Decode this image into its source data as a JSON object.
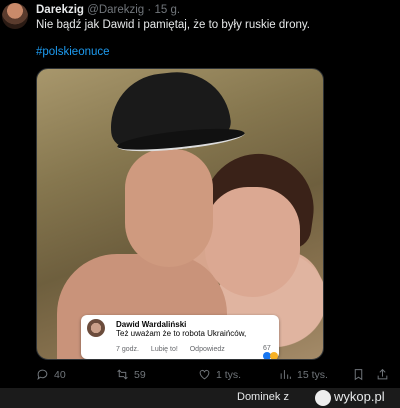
{
  "tweet": {
    "author_name": "Darekzig",
    "author_handle": "@Darekzig",
    "separator": "·",
    "time": "15 g.",
    "text": "Nie bądź jak Dawid i pamiętaj, że to były ruskie drony.",
    "hashtag": "#polskieonuce"
  },
  "embedded_comment": {
    "author": "Dawid Wardaliński",
    "text": "Też uważam że to robota Ukraińców,",
    "time": "7 godz.",
    "like": "Lubię to!",
    "reply": "Odpowiedz",
    "reactions_count": "67"
  },
  "actions": {
    "replies": "40",
    "retweets": "59",
    "likes": "1 tys.",
    "views": "15 tys."
  },
  "footer": {
    "username": "Dominek",
    "connector": "z",
    "brand": "wykop.pl"
  },
  "colors": {
    "background": "#000000",
    "text_primary": "#e7e9ea",
    "text_secondary": "#71767b",
    "hashtag": "#1d9bf0"
  }
}
